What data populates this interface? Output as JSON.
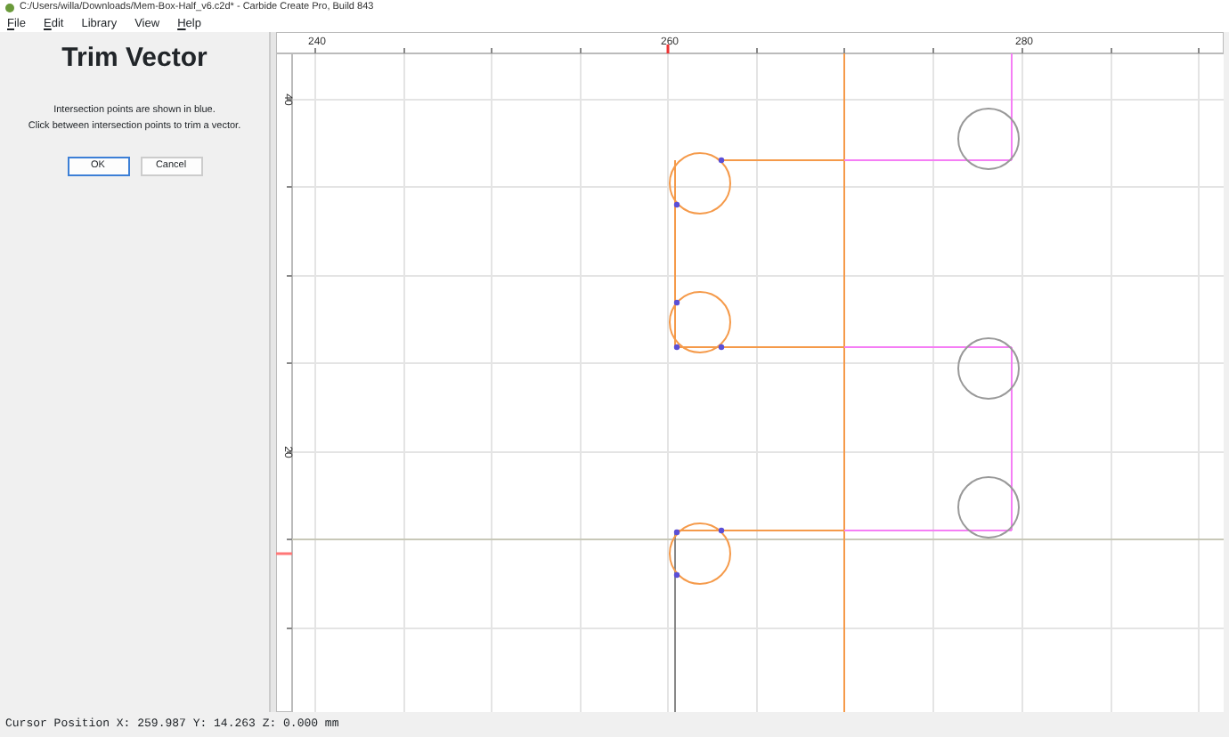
{
  "window": {
    "title": "C:/Users/willa/Downloads/Mem-Box-Half_v6.c2d* - Carbide Create Pro, Build 843"
  },
  "menu": [
    {
      "label": "File",
      "underline_first": true
    },
    {
      "label": "Edit",
      "underline_first": true
    },
    {
      "label": "Library",
      "underline_first": false
    },
    {
      "label": "View",
      "underline_first": false
    },
    {
      "label": "Help",
      "underline_first": true
    }
  ],
  "panel": {
    "title": "Trim Vector",
    "lines": [
      "Intersection points are shown in blue.",
      "Click between intersection points to trim a vector."
    ],
    "buttons": [
      {
        "label": "OK",
        "selected": true
      },
      {
        "label": "Cancel",
        "selected": false
      }
    ]
  },
  "rulers": {
    "x_labels": [
      "240",
      "260",
      "280"
    ],
    "y_labels": [
      "40",
      "20"
    ]
  },
  "status_bar": "Cursor Position X: 259.987 Y: 14.263 Z: 0.000 mm"
}
